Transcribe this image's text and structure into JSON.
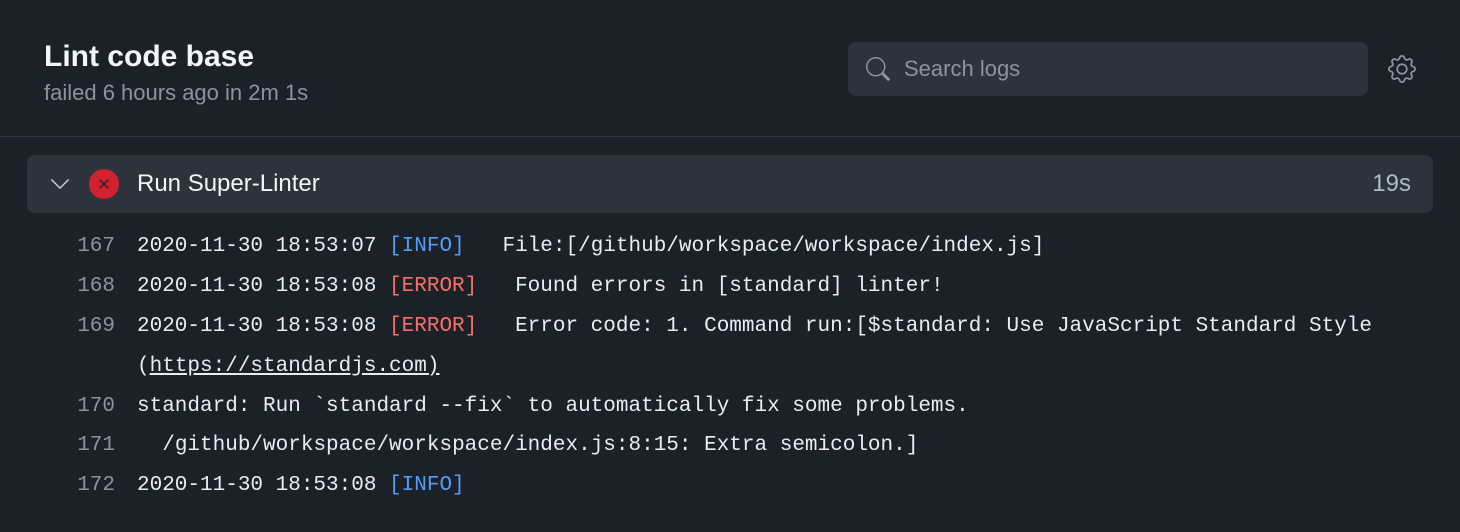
{
  "header": {
    "title": "Lint code base",
    "subtitle": "failed 6 hours ago in 2m 1s"
  },
  "search": {
    "placeholder": "Search logs",
    "value": ""
  },
  "step": {
    "name": "Run Super-Linter",
    "duration": "19s"
  },
  "log_lines": [
    {
      "num": "167",
      "ts": "2020-11-30 18:53:07",
      "level": "INFO",
      "msg": "File:[/github/workspace/workspace/index.js]"
    },
    {
      "num": "168",
      "ts": "2020-11-30 18:53:08",
      "level": "ERROR",
      "msg": "Found errors in [standard] linter!"
    },
    {
      "num": "169",
      "ts": "2020-11-30 18:53:08",
      "level": "ERROR",
      "msg": "Error code: 1. Command run:[$standard: Use JavaScript Standard Style (",
      "link": "https://standardjs.com)"
    },
    {
      "num": "170",
      "ts": "",
      "level": "",
      "msg": "standard: Run `standard --fix` to automatically fix some problems."
    },
    {
      "num": "171",
      "ts": "",
      "level": "",
      "msg": "  /github/workspace/workspace/index.js:8:15: Extra semicolon.]"
    },
    {
      "num": "172",
      "ts": "2020-11-30 18:53:08",
      "level": "INFO",
      "msg": ""
    }
  ]
}
